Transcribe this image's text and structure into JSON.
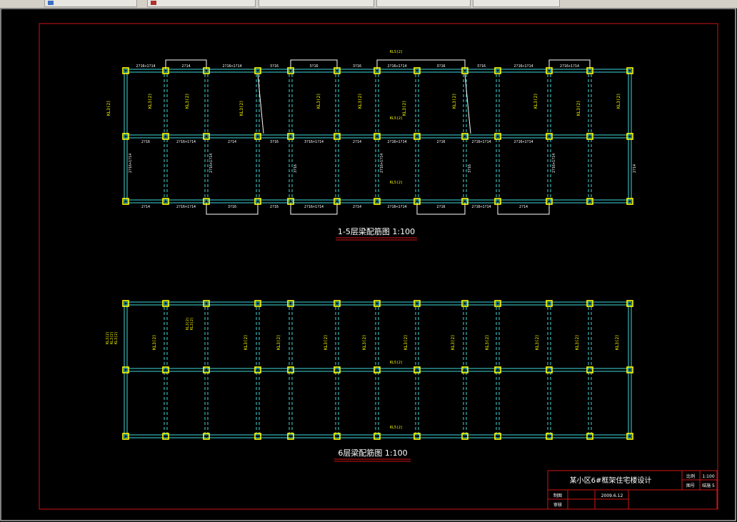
{
  "taskbar": {
    "icon_colors": [
      "#3b6fc4",
      "#b03030"
    ]
  },
  "drawing": {
    "title_top": "1-5层梁配筋图 1:100",
    "title_bottom": "6层梁配筋图 1:100"
  },
  "title_block": {
    "project": "某小区6#框架住宅楼设计",
    "scale_label": "比例",
    "scale_value": "1:100",
    "sheet_label": "图号",
    "sheet_value": "结施 5",
    "drawn_label": "制图",
    "date": "2009.6.12",
    "checked_label": "审核"
  },
  "colors": {
    "frame": "#d01414",
    "beam": "#40d8d8",
    "column": "#ffff00",
    "text": "#ffff00",
    "label_white": "#ffffff",
    "underline": "#d01414"
  },
  "beam_labels": {
    "top_row": [
      "2?16+1?14",
      "2?14",
      "2?16+1?14",
      "3?16",
      "3?16",
      "3?16",
      "2?16+1?14",
      "3?16",
      "3?16",
      "2?16+1?14",
      "2?16+1?14"
    ],
    "mid_row": [
      "2?16",
      "2?16+1?14",
      "2?14",
      "3?16",
      "3?16+1?14",
      "2?14",
      "2?16+1?14",
      "2?16",
      "2?16+1?14",
      "2?16+1?14"
    ],
    "bottom_row": [
      "2?14",
      "2?16+1?14",
      "3?16",
      "2?16",
      "2?16+1?14",
      "2?14",
      "2?16+1?14",
      "2?16",
      "2?16+1?14",
      "2?14"
    ],
    "kl_tags": [
      "KL3(2)",
      "KL3(2)",
      "KL3(2)",
      "KL3(2)",
      "KL3(2)",
      "KL3(2)",
      "KL3(2)",
      "KL3(2)",
      "KL3(2)"
    ],
    "kl_mid": [
      "KL5(2)",
      "KL5(2)"
    ]
  }
}
